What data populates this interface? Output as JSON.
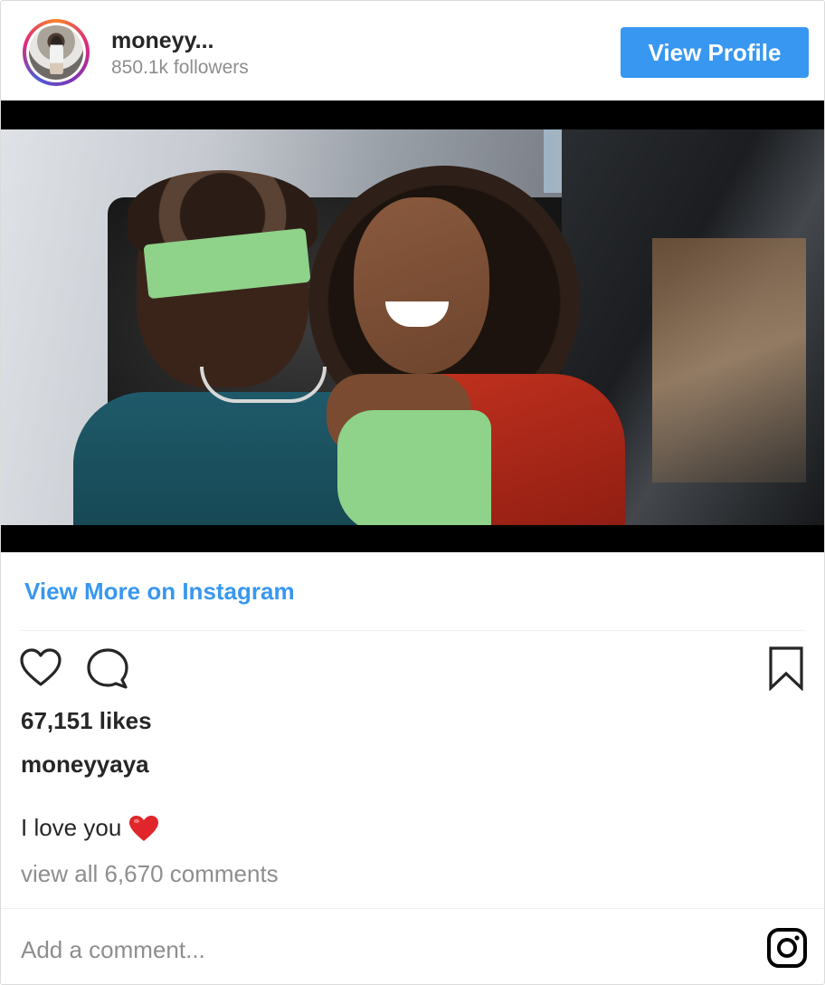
{
  "header": {
    "username": "moneyy...",
    "followers": "850.1k followers",
    "view_profile_label": "View Profile"
  },
  "media": {
    "description_icon": "post-photo"
  },
  "actions": {
    "like_icon": "heart-icon",
    "comment_icon": "comment-icon",
    "save_icon": "bookmark-icon"
  },
  "view_more_label": "View More on Instagram",
  "likes": "67,151 likes",
  "author": "moneyyaya",
  "caption": {
    "text": "I love you",
    "emoji": "❤️"
  },
  "comments_link": "view all 6,670 comments",
  "comment_box": {
    "placeholder": "Add a comment..."
  },
  "colors": {
    "accent": "#3897f0",
    "text": "#262626",
    "muted": "#8e8e8e"
  }
}
